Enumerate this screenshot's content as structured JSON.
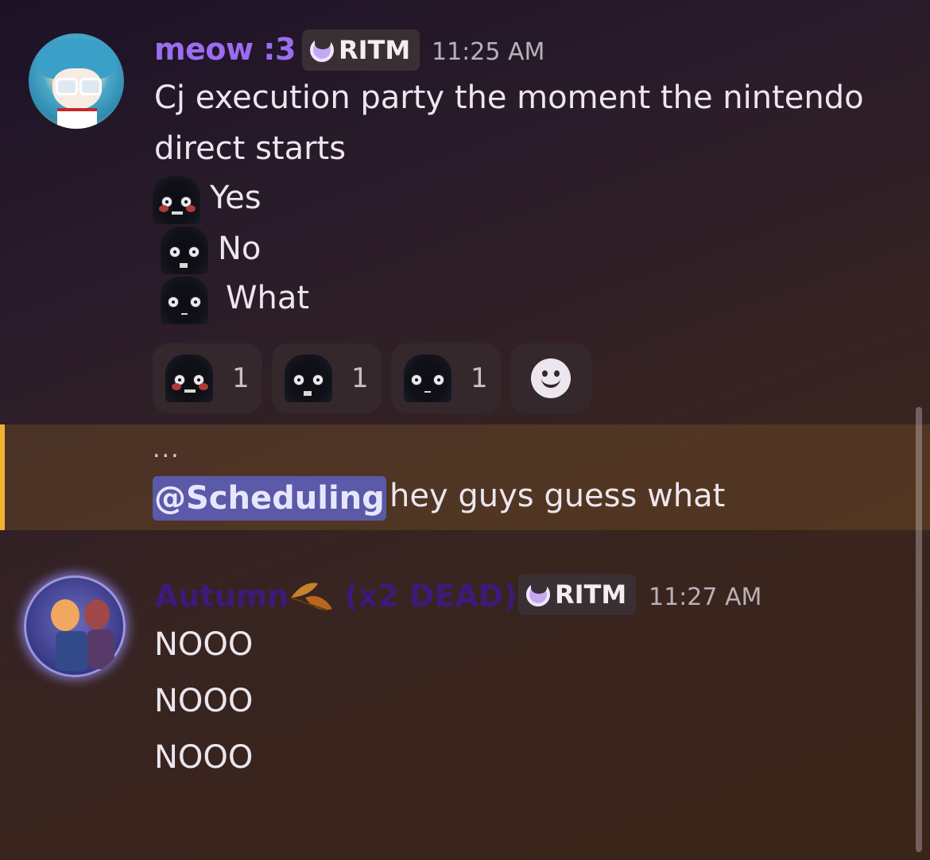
{
  "messages": [
    {
      "author": "meow :3",
      "author_color": "#9b6df2",
      "role": "RITM",
      "timestamp": "11:25 AM",
      "lines": [
        "Cj execution party the moment the nintendo",
        "direct starts"
      ],
      "options": [
        "Yes",
        "No",
        "What"
      ],
      "reactions": [
        {
          "emoji": "blush-hood-emoji",
          "count": "1"
        },
        {
          "emoji": "scared-hood-emoji",
          "count": "1"
        },
        {
          "emoji": "stare-hood-emoji",
          "count": "1"
        }
      ]
    },
    {
      "ellipsis": "...",
      "mention": "@Scheduling",
      "text": "hey guys guess what"
    },
    {
      "author": "Autumn",
      "author_suffix": "(x2 DEAD)",
      "author_color": "#3b1a7a",
      "role": "RITM",
      "timestamp": "11:27 AM",
      "lines": [
        "NOOO",
        "NOOO",
        "NOOO"
      ]
    }
  ],
  "colors": {
    "highlight_bar": "#f0b232",
    "mention_bg": "#5b5aa8"
  },
  "icons": {
    "add_reaction": "smile-add-reaction-icon",
    "role": "crescent-moon-icon",
    "leaf": "autumn-leaf-icon"
  }
}
